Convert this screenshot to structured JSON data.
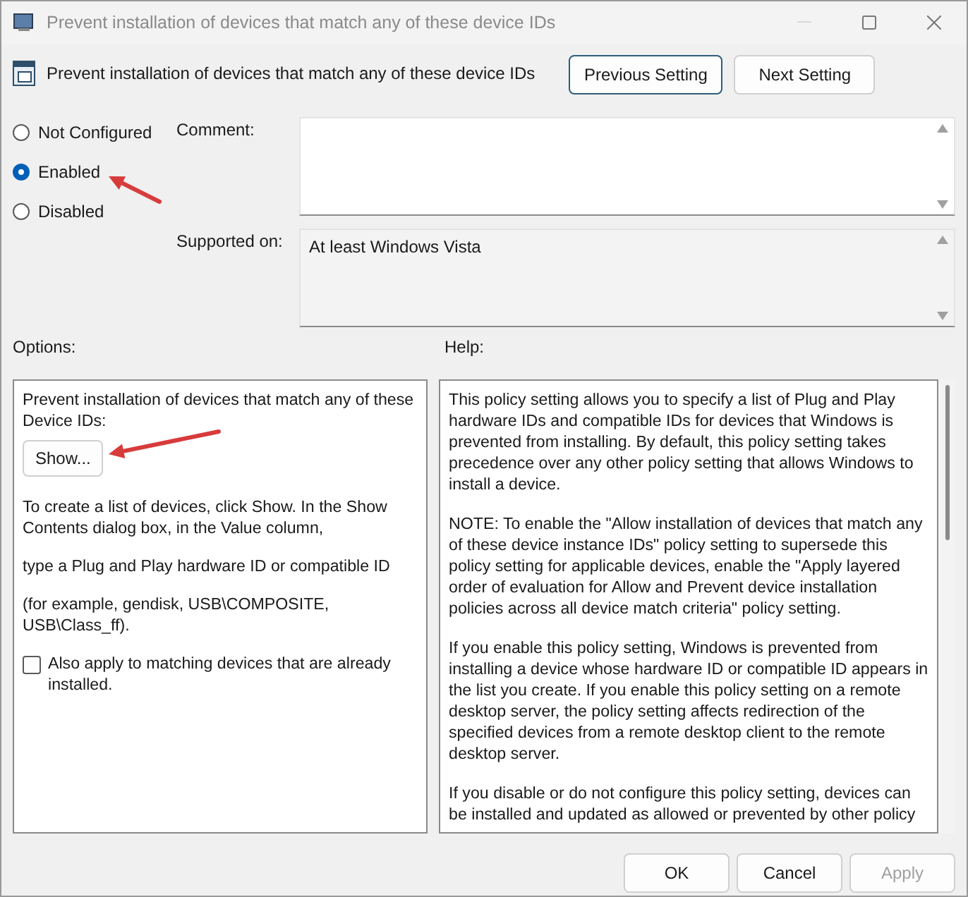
{
  "window": {
    "title": "Prevent installation of devices that match any of these device IDs"
  },
  "header": {
    "title": "Prevent installation of devices that match any of these device IDs",
    "buttons": [
      {
        "label": "Previous Setting",
        "focused": true
      },
      {
        "label": "Next Setting",
        "focused": false
      }
    ]
  },
  "state_options": [
    {
      "label": "Not Configured",
      "selected": false
    },
    {
      "label": "Enabled",
      "selected": true
    },
    {
      "label": "Disabled",
      "selected": false
    }
  ],
  "comment": {
    "label": "Comment:"
  },
  "supported_on": {
    "label": "Supported on:",
    "value": "At least Windows Vista"
  },
  "options": {
    "label": "Options:",
    "intro": "Prevent installation of devices that match any of these Device IDs:",
    "show_button": "Show...",
    "paragraphs": [
      "To create a list of devices, click Show. In the Show Contents dialog box, in the Value column,",
      "type a Plug and Play hardware ID or compatible ID",
      "(for example, gendisk, USB\\COMPOSITE, USB\\Class_ff)."
    ],
    "checkbox": {
      "label": "Also apply to matching devices that are already installed.",
      "checked": false
    }
  },
  "help": {
    "label": "Help:",
    "paragraphs": [
      "This policy setting allows you to specify a list of Plug and Play hardware IDs and compatible IDs for devices that Windows is prevented from installing. By default, this policy setting takes precedence over any other policy setting that allows Windows to install a device.",
      "NOTE: To enable the \"Allow installation of devices that match any of these device instance IDs\" policy setting to supersede this policy setting for applicable devices, enable the \"Apply layered order of evaluation for Allow and Prevent device installation policies across all device match criteria\" policy setting.",
      "If you enable this policy setting, Windows is prevented from installing a device whose hardware ID or compatible ID appears in the list you create. If you enable this policy setting on a remote desktop server, the policy setting affects redirection of the specified devices from a remote desktop client to the remote desktop server.",
      "If you disable or do not configure this policy setting, devices can be installed and updated as allowed or prevented by other policy"
    ]
  },
  "buttons": [
    {
      "label": "OK",
      "disabled": false
    },
    {
      "label": "Cancel",
      "disabled": false
    },
    {
      "label": "Apply",
      "disabled": true
    }
  ]
}
